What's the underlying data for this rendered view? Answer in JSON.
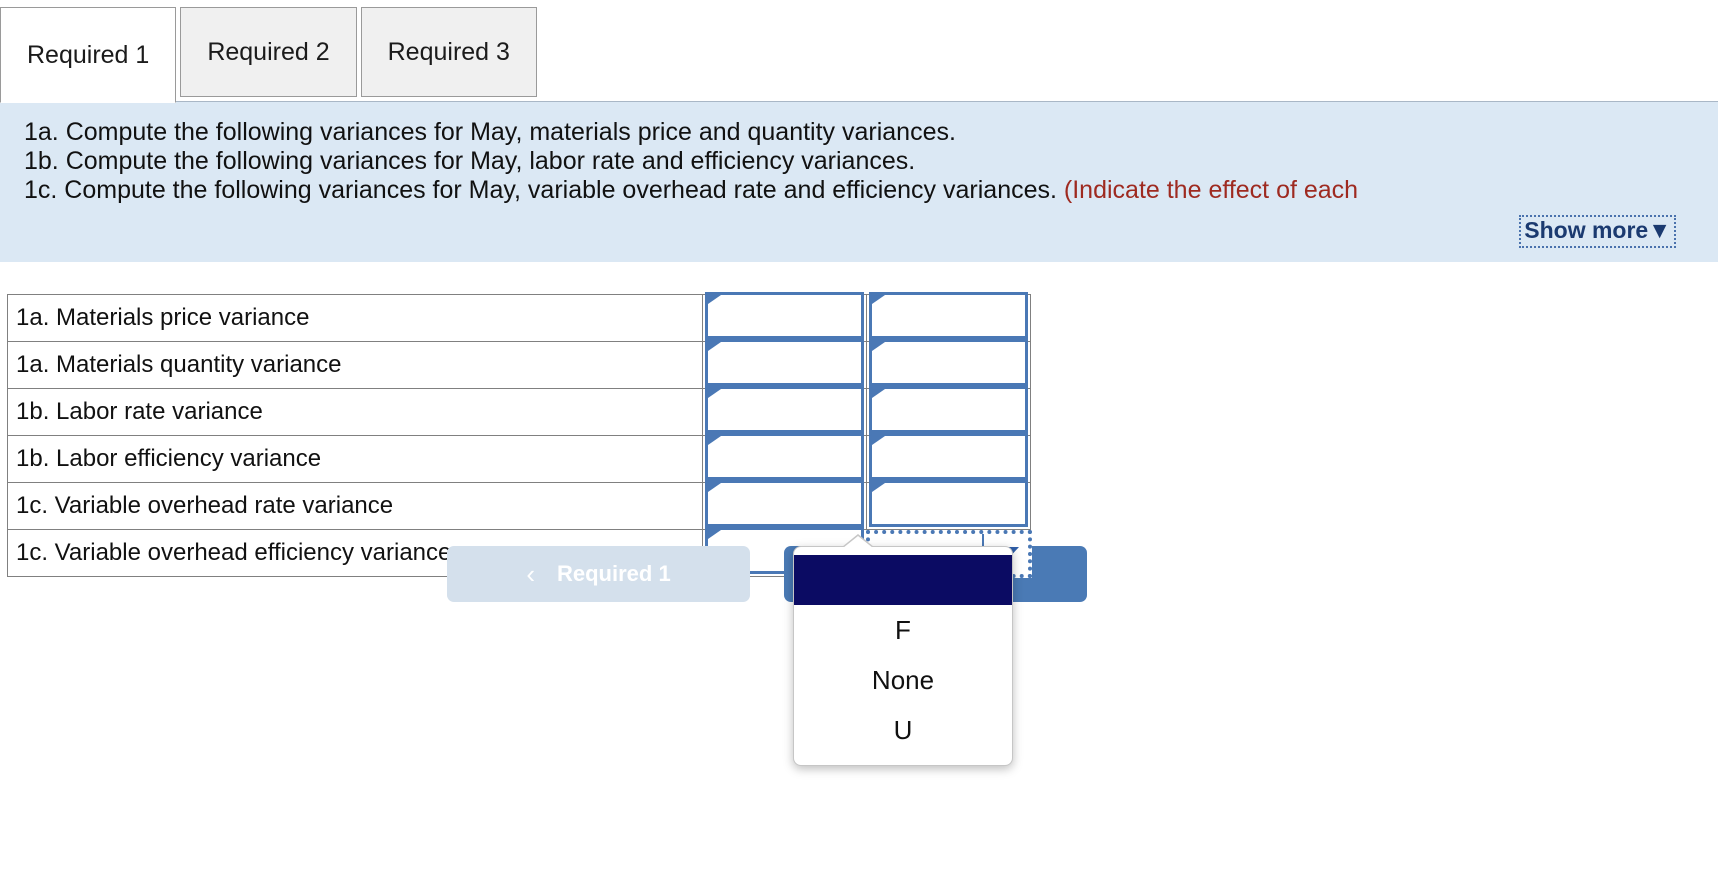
{
  "tabs": [
    {
      "label": "Required 1",
      "active": true
    },
    {
      "label": "Required 2",
      "active": false
    },
    {
      "label": "Required 3",
      "active": false
    }
  ],
  "instructions": {
    "line1": "1a. Compute the following variances for May, materials price and quantity variances.",
    "line2": "1b. Compute the following variances for May, labor rate and efficiency variances.",
    "line3_main": "1c. Compute the following variances for May, variable overhead rate and efficiency variances. ",
    "line3_red": "(Indicate the effect of each",
    "show_more_label": "Show more▼",
    "background_color": "#dbe8f4",
    "red_text_color": "#9e2a20",
    "link_color": "#1b3a70"
  },
  "table": {
    "rows": [
      {
        "label": "1a. Materials price variance",
        "amount": "",
        "effect": ""
      },
      {
        "label": "1a. Materials quantity variance",
        "amount": "",
        "effect": ""
      },
      {
        "label": "1b. Labor rate variance",
        "amount": "",
        "effect": ""
      },
      {
        "label": "1b. Labor efficiency variance",
        "amount": "",
        "effect": ""
      },
      {
        "label": "1c. Variable overhead rate variance",
        "amount": "",
        "effect": ""
      },
      {
        "label": "1c. Variable overhead efficiency variance",
        "amount": "",
        "effect": ""
      }
    ],
    "input_border_color": "#4a78b5",
    "cell_border_color": "#808080"
  },
  "dropdown": {
    "selected_value": "",
    "open": true,
    "options": [
      "",
      "F",
      "None",
      "U"
    ],
    "highlight_color": "#0b0b63"
  },
  "navigation": {
    "prev_label": "Required 1",
    "prev_chevron": "‹",
    "prev_disabled": true,
    "next_label": "",
    "prev_color": "#d4e0ec",
    "next_color": "#4a7ab5"
  }
}
